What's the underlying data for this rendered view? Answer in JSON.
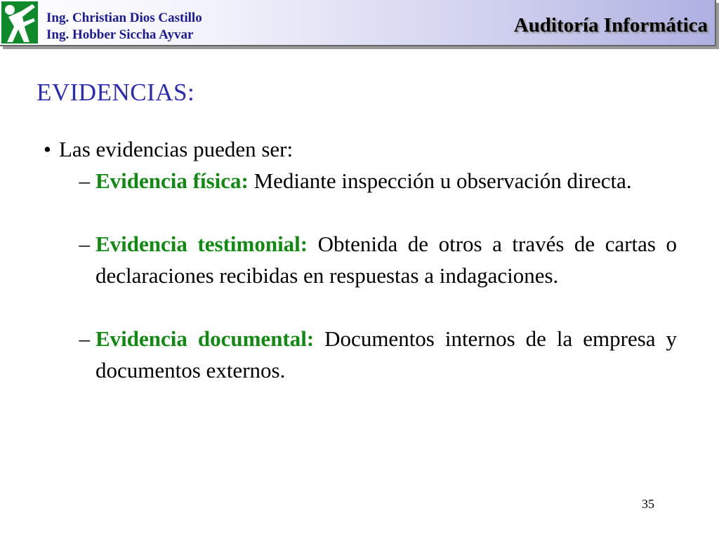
{
  "header": {
    "authors": [
      "Ing. Christian Dios Castillo",
      "Ing. Hobber Siccha Ayvar"
    ],
    "course_title": "Auditoría Informática",
    "logo_icon": "figure-logo-icon",
    "gradient_colors": [
      "#ffffff",
      "#aeb0e2"
    ]
  },
  "slide": {
    "title": "EVIDENCIAS:",
    "bullet": "Las evidencias pueden ser:",
    "items": [
      {
        "term": "Evidencia física:",
        "text": "Mediante inspección u observación directa."
      },
      {
        "term": "Evidencia testimonial:",
        "text": "Obtenida de otros a través de cartas o declaraciones recibidas en respuestas a indagaciones."
      },
      {
        "term": "Evidencia documental:",
        "text": "Documentos internos de la empresa y documentos externos."
      }
    ],
    "page_number": "35"
  },
  "colors": {
    "title": "#2b2bb3",
    "term": "#118a11",
    "authors": "#1a1a99"
  }
}
